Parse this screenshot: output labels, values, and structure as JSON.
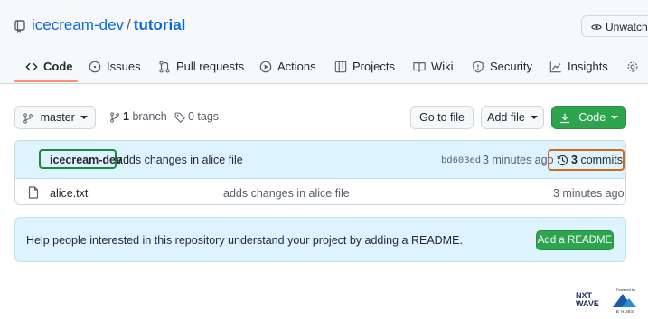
{
  "repo": {
    "owner": "icecream-dev",
    "separator": "/",
    "name": "tutorial",
    "watch_label": "Unwatch"
  },
  "tabs": [
    {
      "label": "Code",
      "icon": "code-icon",
      "active": true
    },
    {
      "label": "Issues",
      "icon": "issue-opened-icon"
    },
    {
      "label": "Pull requests",
      "icon": "git-pull-request-icon"
    },
    {
      "label": "Actions",
      "icon": "play-icon"
    },
    {
      "label": "Projects",
      "icon": "table-icon"
    },
    {
      "label": "Wiki",
      "icon": "book-icon"
    },
    {
      "label": "Security",
      "icon": "shield-icon"
    },
    {
      "label": "Insights",
      "icon": "graph-icon"
    }
  ],
  "toolbar": {
    "branch_label": "master",
    "branch_count": "1",
    "branch_word": "branch",
    "tags_label": "0 tags",
    "go_to_file": "Go to file",
    "add_file": "Add file",
    "code_button": "Code"
  },
  "latest_commit": {
    "author": "icecream-dev",
    "message": "adds changes in alice file",
    "sha": "bd603ed",
    "time": "3 minutes ago",
    "commit_count": "3",
    "commit_word": "commits"
  },
  "files": [
    {
      "name": "alice.txt",
      "message": "adds changes in alice file",
      "time": "3 minutes ago"
    }
  ],
  "readme_banner": {
    "text": "Help people interested in this repository understand your project by adding a README.",
    "button": "Add a README"
  },
  "watermark": {
    "powered_by": "Powered by",
    "brand_line1": "NXT",
    "brand_line2": "WAVE",
    "partner": "IB HUBS"
  },
  "colors": {
    "accent_blue": "#0969da",
    "green": "#2da44e",
    "tab_underline": "#fd8c73",
    "author_highlight": "#1f883d",
    "commits_highlight": "#d5681c"
  }
}
